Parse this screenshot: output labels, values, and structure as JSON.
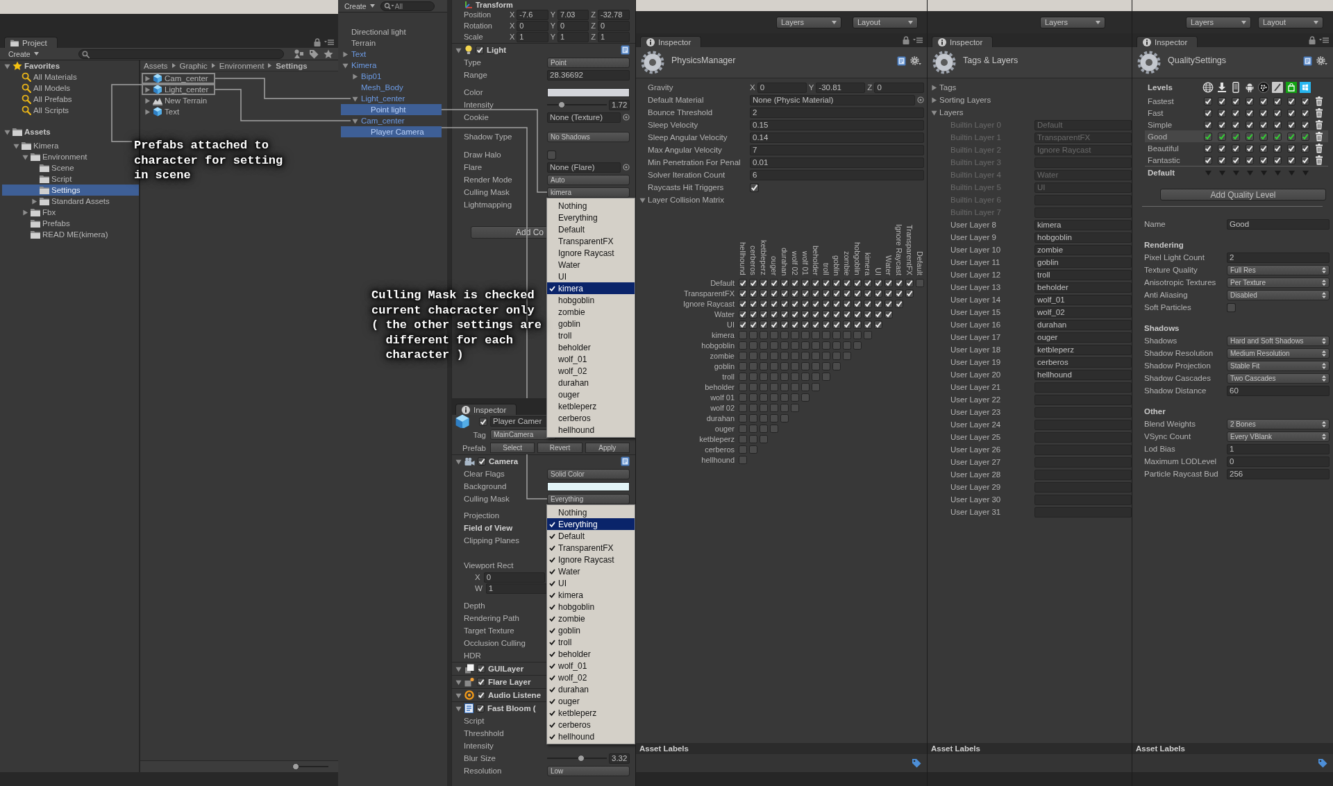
{
  "project": {
    "tab": "Project",
    "create_button": "Create",
    "favorites": {
      "label": "Favorites",
      "expanded": true,
      "items": [
        {
          "label": "All Materials",
          "selected": false
        },
        {
          "label": "All Models",
          "selected": false
        },
        {
          "label": "All Prefabs",
          "selected": false
        },
        {
          "label": "All Scripts",
          "selected": false
        }
      ]
    },
    "assets": {
      "label": "Assets",
      "expanded": true,
      "selected": false,
      "children": [
        {
          "label": "Kimera",
          "expanded": true,
          "selected": false,
          "children": [
            {
              "label": "Environment",
              "expanded": true,
              "selected": false,
              "children": [
                {
                  "label": "Scene",
                  "selected": false
                },
                {
                  "label": "Script",
                  "selected": false
                },
                {
                  "label": "Settings",
                  "selected": true
                },
                {
                  "label": "Standard Assets",
                  "expanded": false,
                  "selected": false
                }
              ]
            },
            {
              "label": "Fbx",
              "expanded": false,
              "selected": false
            },
            {
              "label": "Prefabs",
              "selected": false
            },
            {
              "label": "READ ME(kimera)",
              "selected": false
            }
          ]
        }
      ]
    },
    "breadcrumb": [
      "Assets",
      "Graphic",
      "Environment",
      "Settings"
    ],
    "files": [
      {
        "label": "Cam_center",
        "kind": "prefab",
        "expanded": false,
        "highlighted": true
      },
      {
        "label": "Light_center",
        "kind": "prefab",
        "expanded": false,
        "highlighted": true
      },
      {
        "label": "New Terrain",
        "kind": "terrain",
        "expanded": false,
        "highlighted": false
      },
      {
        "label": "Text",
        "kind": "prefab",
        "expanded": false,
        "highlighted": false
      }
    ],
    "icon_size_slider": {
      "level": 0
    }
  },
  "hierarchy": {
    "create_button": "Create",
    "search": {
      "placeholder": "All"
    },
    "items": [
      {
        "label": "Directional light",
        "prefab": false,
        "selected": false
      },
      {
        "label": "Terrain",
        "prefab": false,
        "selected": false
      },
      {
        "label": "Text",
        "prefab": true,
        "expanded": false,
        "selected": false
      },
      {
        "label": "Kimera",
        "prefab": true,
        "expanded": true,
        "selected": false,
        "children": [
          {
            "label": "Bip01",
            "prefab": true,
            "expanded": false,
            "selected": false
          },
          {
            "label": "Mesh_Body",
            "prefab": true,
            "selected": false
          },
          {
            "label": "Light_center",
            "prefab": true,
            "expanded": true,
            "selected": false,
            "children": [
              {
                "label": "Point light",
                "prefab": true,
                "selected": true
              }
            ]
          },
          {
            "label": "Cam_center",
            "prefab": true,
            "expanded": true,
            "selected": false,
            "children": [
              {
                "label": "Player Camera",
                "prefab": true,
                "selected": true
              }
            ]
          }
        ]
      }
    ]
  },
  "light_inspector": {
    "transform": {
      "title": "Transform",
      "rows": [
        {
          "label": "Position",
          "values": [
            {
              "axis": "X",
              "value": "-7.6"
            },
            {
              "axis": "Y",
              "value": "7.03"
            },
            {
              "axis": "Z",
              "value": "-32.78"
            }
          ]
        },
        {
          "label": "Rotation",
          "values": [
            {
              "axis": "X",
              "value": "0"
            },
            {
              "axis": "Y",
              "value": "0"
            },
            {
              "axis": "Z",
              "value": "0"
            }
          ]
        },
        {
          "label": "Scale",
          "values": [
            {
              "axis": "X",
              "value": "1"
            },
            {
              "axis": "Y",
              "value": "1"
            },
            {
              "axis": "Z",
              "value": "1"
            }
          ]
        }
      ]
    },
    "light": {
      "kind": "light",
      "title": "Light",
      "enabled": true,
      "expanded": true,
      "fields": [
        {
          "kind": "dropdown",
          "label": "Type",
          "value": "Point"
        },
        {
          "kind": "text",
          "label": "Range",
          "value": "28.36692"
        },
        {
          "kind": "color",
          "label": "Color",
          "color": "#d3d5da"
        },
        {
          "kind": "slider",
          "label": "Intensity",
          "level": 0.215,
          "value": "1.72"
        },
        {
          "kind": "object",
          "label": "Cookie",
          "value": "None (Texture)"
        },
        {
          "kind": "dropdown",
          "label": "Shadow Type",
          "value": "No Shadows"
        },
        {
          "kind": "checkbox",
          "label": "Draw Halo",
          "checked": false
        },
        {
          "kind": "object",
          "label": "Flare",
          "value": "None (Flare)"
        },
        {
          "kind": "dropdown",
          "label": "Render Mode",
          "value": "Auto"
        },
        {
          "kind": "mask",
          "label": "Culling Mask",
          "value": "kimera",
          "open": true,
          "menu": [
            {
              "label": "Nothing",
              "checked": false,
              "selected": false
            },
            {
              "label": "Everything",
              "checked": false,
              "selected": false
            },
            {
              "label": "Default",
              "checked": false,
              "selected": false
            },
            {
              "label": "TransparentFX",
              "checked": false,
              "selected": false
            },
            {
              "label": "Ignore Raycast",
              "checked": false,
              "selected": false
            },
            {
              "label": "Water",
              "checked": false,
              "selected": false
            },
            {
              "label": "UI",
              "checked": false,
              "selected": false
            },
            {
              "label": "kimera",
              "checked": true,
              "selected": true
            },
            {
              "label": "hobgoblin",
              "checked": false,
              "selected": false
            },
            {
              "label": "zombie",
              "checked": false,
              "selected": false
            },
            {
              "label": "goblin",
              "checked": false,
              "selected": false
            },
            {
              "label": "troll",
              "checked": false,
              "selected": false
            },
            {
              "label": "beholder",
              "checked": false,
              "selected": false
            },
            {
              "label": "wolf_01",
              "checked": false,
              "selected": false
            },
            {
              "label": "wolf_02",
              "checked": false,
              "selected": false
            },
            {
              "label": "durahan",
              "checked": false,
              "selected": false
            },
            {
              "label": "ouger",
              "checked": false,
              "selected": false
            },
            {
              "label": "ketbleperz",
              "checked": false,
              "selected": false
            },
            {
              "label": "cerberos",
              "checked": false,
              "selected": false
            },
            {
              "label": "hellhound",
              "checked": false,
              "selected": false
            }
          ]
        },
        {
          "kind": "label",
          "label": "Lightmapping"
        }
      ]
    },
    "add_component_button": "Add Co"
  },
  "camera_inspector": {
    "tab": "Inspector",
    "object": {
      "active": true,
      "name": "Player Camer",
      "tag_label": "Tag",
      "tag": "MainCamera",
      "prefab_label": "Prefab",
      "prefab_buttons": [
        "Select",
        "Revert",
        "Apply"
      ]
    },
    "components": [
      {
        "kind": "camera",
        "title": "Camera",
        "enabled": true,
        "expanded": true,
        "fields": [
          {
            "kind": "dropdown",
            "label": "Clear Flags",
            "value": "Solid Color",
            "modified": false
          },
          {
            "kind": "color",
            "label": "Background",
            "color": "#e3f5f8",
            "modified": false
          },
          {
            "kind": "mask",
            "label": "Culling Mask",
            "value": "Everything",
            "open": true,
            "modified": false,
            "menu": [
              {
                "label": "Nothing",
                "checked": false,
                "selected": false
              },
              {
                "label": "Everything",
                "checked": true,
                "selected": true
              },
              {
                "label": "Default",
                "checked": true,
                "selected": false
              },
              {
                "label": "TransparentFX",
                "checked": true,
                "selected": false
              },
              {
                "label": "Ignore Raycast",
                "checked": true,
                "selected": false
              },
              {
                "label": "Water",
                "checked": true,
                "selected": false
              },
              {
                "label": "UI",
                "checked": true,
                "selected": false
              },
              {
                "label": "kimera",
                "checked": true,
                "selected": false
              },
              {
                "label": "hobgoblin",
                "checked": true,
                "selected": false
              },
              {
                "label": "zombie",
                "checked": true,
                "selected": false
              },
              {
                "label": "goblin",
                "checked": true,
                "selected": false
              },
              {
                "label": "troll",
                "checked": true,
                "selected": false
              },
              {
                "label": "beholder",
                "checked": true,
                "selected": false
              },
              {
                "label": "wolf_01",
                "checked": true,
                "selected": false
              },
              {
                "label": "wolf_02",
                "checked": true,
                "selected": false
              },
              {
                "label": "durahan",
                "checked": true,
                "selected": false
              },
              {
                "label": "ouger",
                "checked": true,
                "selected": false
              },
              {
                "label": "ketbleperz",
                "checked": true,
                "selected": false
              },
              {
                "label": "cerberos",
                "checked": true,
                "selected": false
              },
              {
                "label": "hellhound",
                "checked": true,
                "selected": false
              }
            ]
          },
          {
            "kind": "label",
            "label": "Projection",
            "modified": false
          },
          {
            "kind": "label",
            "label": "Field of View",
            "modified": true
          },
          {
            "kind": "range",
            "label": "Clipping Planes",
            "modified": false
          },
          {
            "kind": "rect",
            "label": "Viewport Rect",
            "modified": false,
            "values": [
              {
                "axis": "X",
                "value": "0"
              },
              {
                "axis": "W",
                "value": "1"
              }
            ]
          },
          {
            "kind": "label",
            "label": "Depth",
            "modified": false
          },
          {
            "kind": "label",
            "label": "Rendering Path",
            "modified": false
          },
          {
            "kind": "label",
            "label": "Target Texture",
            "modified": false
          },
          {
            "kind": "label",
            "label": "Occlusion Culling",
            "modified": false
          },
          {
            "kind": "label",
            "label": "HDR",
            "modified": false
          }
        ]
      },
      {
        "kind": "gui_layer",
        "title": "GUILayer",
        "enabled": true,
        "expanded": true
      },
      {
        "kind": "flare_layer",
        "title": "Flare Layer",
        "enabled": true,
        "expanded": true
      },
      {
        "kind": "audio_listener",
        "title": "Audio Listene",
        "enabled": true,
        "expanded": true
      },
      {
        "kind": "script",
        "title": "Fast Bloom (",
        "enabled": true,
        "expanded": true,
        "fields": [
          {
            "kind": "label",
            "label": "Script"
          },
          {
            "kind": "label",
            "label": "Threshhold"
          },
          {
            "kind": "label",
            "label": "Intensity"
          },
          {
            "kind": "slider",
            "label": "Blur Size",
            "level": 0.58,
            "value": "3.32"
          },
          {
            "kind": "dropdown",
            "label": "Resolution",
            "value": "Low"
          }
        ]
      }
    ]
  },
  "physics_manager": {
    "toolbar": [
      "Layers",
      "Layout"
    ],
    "tab": "Inspector",
    "title": "PhysicsManager",
    "fields": [
      {
        "kind": "vector3",
        "label": "Gravity",
        "values": [
          {
            "axis": "X",
            "value": "0"
          },
          {
            "axis": "Y",
            "value": "-30.81"
          },
          {
            "axis": "Z",
            "value": "0"
          }
        ]
      },
      {
        "kind": "object",
        "label": "Default Material",
        "value": "None (Physic Material)"
      },
      {
        "kind": "text",
        "label": "Bounce Threshold",
        "value": "2"
      },
      {
        "kind": "text",
        "label": "Sleep Velocity",
        "value": "0.15"
      },
      {
        "kind": "text",
        "label": "Sleep Angular Velocity",
        "value": "0.14"
      },
      {
        "kind": "text",
        "label": "Max Angular Velocity",
        "value": "7"
      },
      {
        "kind": "text",
        "label": "Min Penetration For Penal",
        "value": "0.01"
      },
      {
        "kind": "text",
        "label": "Solver Iteration Count",
        "value": "6"
      },
      {
        "kind": "checkbox",
        "label": "Raycasts Hit Triggers",
        "checked": true
      }
    ],
    "collision_matrix": {
      "label": "Layer Collision Matrix",
      "expanded": true,
      "columns": [
        "hellhound",
        "cerberos",
        "ketbleperz",
        "ouger",
        "durahan",
        "wolf 02",
        "wolf 01",
        "beholder",
        "troll",
        "goblin",
        "zombie",
        "hobgoblin",
        "kimera",
        "UI",
        "Water",
        "Ignore Raycast",
        "TransparentFX",
        "Default"
      ],
      "rows": [
        {
          "label": "Default",
          "checked": [
            true,
            true,
            true,
            true,
            true,
            true,
            true,
            true,
            true,
            true,
            true,
            true,
            true,
            true,
            true,
            true,
            true,
            false
          ]
        },
        {
          "label": "TransparentFX",
          "checked": [
            true,
            true,
            true,
            true,
            true,
            true,
            true,
            true,
            true,
            true,
            true,
            true,
            true,
            true,
            true,
            true,
            true
          ]
        },
        {
          "label": "Ignore Raycast",
          "checked": [
            true,
            true,
            true,
            true,
            true,
            true,
            true,
            true,
            true,
            true,
            true,
            true,
            true,
            true,
            true,
            true
          ]
        },
        {
          "label": "Water",
          "checked": [
            true,
            true,
            true,
            true,
            true,
            true,
            true,
            true,
            true,
            true,
            true,
            true,
            true,
            true,
            true
          ]
        },
        {
          "label": "UI",
          "checked": [
            true,
            true,
            true,
            true,
            true,
            true,
            true,
            true,
            true,
            true,
            true,
            true,
            true,
            true
          ]
        },
        {
          "label": "kimera",
          "checked": [
            false,
            false,
            false,
            false,
            false,
            false,
            false,
            false,
            false,
            false,
            false,
            false,
            false
          ]
        },
        {
          "label": "hobgoblin",
          "checked": [
            false,
            false,
            false,
            false,
            false,
            false,
            false,
            false,
            false,
            false,
            false,
            false
          ]
        },
        {
          "label": "zombie",
          "checked": [
            false,
            false,
            false,
            false,
            false,
            false,
            false,
            false,
            false,
            false,
            false
          ]
        },
        {
          "label": "goblin",
          "checked": [
            false,
            false,
            false,
            false,
            false,
            false,
            false,
            false,
            false,
            false
          ]
        },
        {
          "label": "troll",
          "checked": [
            false,
            false,
            false,
            false,
            false,
            false,
            false,
            false,
            false
          ]
        },
        {
          "label": "beholder",
          "checked": [
            false,
            false,
            false,
            false,
            false,
            false,
            false,
            false
          ]
        },
        {
          "label": "wolf 01",
          "checked": [
            false,
            false,
            false,
            false,
            false,
            false,
            false
          ]
        },
        {
          "label": "wolf 02",
          "checked": [
            false,
            false,
            false,
            false,
            false,
            false
          ]
        },
        {
          "label": "durahan",
          "checked": [
            false,
            false,
            false,
            false,
            false
          ]
        },
        {
          "label": "ouger",
          "checked": [
            false,
            false,
            false,
            false
          ]
        },
        {
          "label": "ketbleperz",
          "checked": [
            false,
            false,
            false
          ]
        },
        {
          "label": "cerberos",
          "checked": [
            false,
            false
          ]
        },
        {
          "label": "hellhound",
          "checked": [
            false
          ]
        }
      ]
    },
    "asset_labels": {
      "label": "Asset Labels",
      "tag_button": true
    }
  },
  "tags_and_layers": {
    "toolbar": [
      "Layers"
    ],
    "tab": "Inspector",
    "title": "Tags & Layers",
    "sections": [
      {
        "label": "Tags",
        "expanded": false
      },
      {
        "label": "Sorting Layers",
        "expanded": false
      },
      {
        "label": "Layers",
        "expanded": true,
        "layers": [
          {
            "label": "Builtin Layer 0",
            "value": "Default",
            "disabled": true
          },
          {
            "label": "Builtin Layer 1",
            "value": "TransparentFX",
            "disabled": true
          },
          {
            "label": "Builtin Layer 2",
            "value": "Ignore Raycast",
            "disabled": true
          },
          {
            "label": "Builtin Layer 3",
            "disabled": true
          },
          {
            "label": "Builtin Layer 4",
            "value": "Water",
            "disabled": true
          },
          {
            "label": "Builtin Layer 5",
            "value": "UI",
            "disabled": true
          },
          {
            "label": "Builtin Layer 6",
            "disabled": true
          },
          {
            "label": "Builtin Layer 7",
            "disabled": true
          },
          {
            "label": "User Layer 8",
            "value": "kimera",
            "disabled": false
          },
          {
            "label": "User Layer 9",
            "value": "hobgoblin",
            "disabled": false
          },
          {
            "label": "User Layer 10",
            "value": "zombie",
            "disabled": false
          },
          {
            "label": "User Layer 11",
            "value": "goblin",
            "disabled": false
          },
          {
            "label": "User Layer 12",
            "value": "troll",
            "disabled": false
          },
          {
            "label": "User Layer 13",
            "value": "beholder",
            "disabled": false
          },
          {
            "label": "User Layer 14",
            "value": "wolf_01",
            "disabled": false
          },
          {
            "label": "User Layer 15",
            "value": "wolf_02",
            "disabled": false
          },
          {
            "label": "User Layer 16",
            "value": "durahan",
            "disabled": false
          },
          {
            "label": "User Layer 17",
            "value": "ouger",
            "disabled": false
          },
          {
            "label": "User Layer 18",
            "value": "ketbleperz",
            "disabled": false
          },
          {
            "label": "User Layer 19",
            "value": "cerberos",
            "disabled": false
          },
          {
            "label": "User Layer 20",
            "value": "hellhound",
            "disabled": false
          },
          {
            "label": "User Layer 21",
            "disabled": false
          },
          {
            "label": "User Layer 22",
            "disabled": false
          },
          {
            "label": "User Layer 23",
            "disabled": false
          },
          {
            "label": "User Layer 24",
            "disabled": false
          },
          {
            "label": "User Layer 25",
            "disabled": false
          },
          {
            "label": "User Layer 26",
            "disabled": false
          },
          {
            "label": "User Layer 27",
            "disabled": false
          },
          {
            "label": "User Layer 28",
            "disabled": false
          },
          {
            "label": "User Layer 29",
            "disabled": false
          },
          {
            "label": "User Layer 30",
            "disabled": false
          },
          {
            "label": "User Layer 31",
            "disabled": false
          }
        ]
      }
    ],
    "asset_labels": {
      "label": "Asset Labels",
      "tag_button": false
    }
  },
  "quality_settings": {
    "toolbar": [
      "Layers",
      "Layout"
    ],
    "tab": "Inspector",
    "title": "QualitySettings",
    "levels_label": "Levels",
    "platforms": [
      {
        "kind": "globe"
      },
      {
        "kind": "download"
      },
      {
        "kind": "phone"
      },
      {
        "kind": "robot"
      },
      {
        "kind": "dots"
      },
      {
        "kind": "slash"
      },
      {
        "kind": "bag"
      },
      {
        "kind": "window"
      }
    ],
    "levels": [
      {
        "label": "Fastest",
        "selected": false,
        "default": false,
        "checked": [
          true,
          true,
          true,
          true,
          true,
          true,
          true,
          true
        ]
      },
      {
        "label": "Fast",
        "selected": false,
        "default": false,
        "checked": [
          true,
          true,
          true,
          true,
          true,
          true,
          true,
          true
        ]
      },
      {
        "label": "Simple",
        "selected": false,
        "default": false,
        "checked": [
          true,
          true,
          true,
          true,
          true,
          true,
          true,
          true
        ]
      },
      {
        "label": "Good",
        "selected": true,
        "default": true,
        "checked": [
          true,
          true,
          true,
          true,
          true,
          true,
          true,
          true
        ]
      },
      {
        "label": "Beautiful",
        "selected": false,
        "default": false,
        "checked": [
          true,
          true,
          true,
          true,
          true,
          true,
          true,
          true
        ]
      },
      {
        "label": "Fantastic",
        "selected": false,
        "default": false,
        "checked": [
          true,
          true,
          true,
          true,
          true,
          true,
          true,
          true
        ]
      }
    ],
    "default_label": "Default",
    "add_button": "Add Quality Level",
    "name_label": "Name",
    "name": "Good",
    "sections": [
      {
        "title": "Rendering",
        "fields": [
          {
            "kind": "text",
            "label": "Pixel Light Count",
            "value": "2"
          },
          {
            "kind": "dropdown",
            "label": "Texture Quality",
            "value": "Full Res"
          },
          {
            "kind": "dropdown",
            "label": "Anisotropic Textures",
            "value": "Per Texture"
          },
          {
            "kind": "dropdown",
            "label": "Anti Aliasing",
            "value": "Disabled"
          },
          {
            "kind": "checkbox",
            "label": "Soft Particles",
            "checked": false
          }
        ]
      },
      {
        "title": "Shadows",
        "fields": [
          {
            "kind": "dropdown",
            "label": "Shadows",
            "value": "Hard and Soft Shadows"
          },
          {
            "kind": "dropdown",
            "label": "Shadow Resolution",
            "value": "Medium Resolution"
          },
          {
            "kind": "dropdown",
            "label": "Shadow Projection",
            "value": "Stable Fit"
          },
          {
            "kind": "dropdown",
            "label": "Shadow Cascades",
            "value": "Two Cascades"
          },
          {
            "kind": "text",
            "label": "Shadow Distance",
            "value": "60"
          }
        ]
      },
      {
        "title": "Other",
        "fields": [
          {
            "kind": "dropdown",
            "label": "Blend Weights",
            "value": "2 Bones"
          },
          {
            "kind": "dropdown",
            "label": "VSync Count",
            "value": "Every VBlank"
          },
          {
            "kind": "text",
            "label": "Lod Bias",
            "value": "1"
          },
          {
            "kind": "text",
            "label": "Maximum LODLevel",
            "value": "0"
          },
          {
            "kind": "text",
            "label": "Particle Raycast Bud",
            "value": "256"
          }
        ]
      }
    ],
    "asset_labels": {
      "label": "Asset Labels",
      "tag_button": true
    }
  },
  "annotations": [
    {
      "text": "Prefabs attached to\ncharacter for setting\nin scene"
    },
    {
      "text": "Culling Mask is checked\ncurrent chacracter only\n( the other settings are\n  different for each\n  character )"
    }
  ]
}
